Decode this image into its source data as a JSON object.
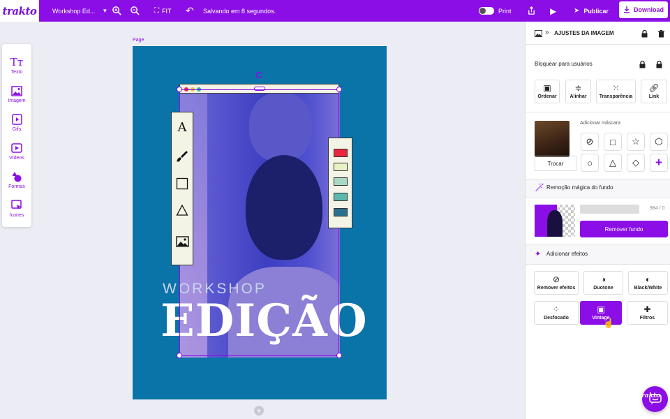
{
  "topbar": {
    "logo": "trakto",
    "doc_title": "Workshop Ed...",
    "fit_label": "FIT",
    "status": "Salvando em 8 segundos.",
    "print_label": "Print",
    "publish_label": "Publicar",
    "download_label": "Download"
  },
  "tools": [
    {
      "label": "Texto",
      "icon": "text-icon"
    },
    {
      "label": "Imagem",
      "icon": "image-icon"
    },
    {
      "label": "Gifs",
      "icon": "gif-icon"
    },
    {
      "label": "Vídeos",
      "icon": "video-icon"
    },
    {
      "label": "Formas",
      "icon": "shapes-icon"
    },
    {
      "label": "Ícones",
      "icon": "icons-icon"
    }
  ],
  "canvas": {
    "page_label": "Page",
    "headline_small": "WORKSHOP",
    "headline_big": "EDIÇÃO",
    "background_color": "#0a73a8",
    "swatches": [
      "#e8273f",
      "#e9f2c5",
      "#a9d8c4",
      "#5cb8ad",
      "#2b6f8f"
    ],
    "float_tool_glyphs": [
      "A",
      "🖌",
      "□",
      "△",
      "▣"
    ]
  },
  "right_panel": {
    "title": "AJUSTES DA IMAGEM",
    "lock_section": "Bloquear para usuários",
    "actions": [
      {
        "label": "Ordenar",
        "icon": "layers-icon"
      },
      {
        "label": "Alinhar",
        "icon": "align-icon"
      },
      {
        "label": "Transparência",
        "icon": "transparency-icon"
      },
      {
        "label": "Link",
        "icon": "link-icon"
      }
    ],
    "mask_section": "Adicionar máscara",
    "swap_label": "Trocar",
    "mask_shapes": [
      "⊘",
      "□",
      "☆",
      "⬡",
      "○",
      "△",
      "◇",
      "+"
    ],
    "bg_removal_title": "Remoção mágica do fundo",
    "bg_removal_count": "984 / 0",
    "bg_removal_button": "Remover fundo",
    "effects_title": "Adicionar efeitos",
    "effects": [
      {
        "label": "Remover efeitos",
        "icon": "⊘",
        "active": false
      },
      {
        "label": "Duotone",
        "icon": "◑",
        "active": false
      },
      {
        "label": "Black/White",
        "icon": "◐",
        "active": false
      },
      {
        "label": "Desfocado",
        "icon": "⁘",
        "active": false
      },
      {
        "label": "Vintage",
        "icon": "▣",
        "active": true
      },
      {
        "label": "Filtros",
        "icon": "✚",
        "active": false
      }
    ]
  },
  "colors": {
    "brand": "#8b0ee6"
  }
}
